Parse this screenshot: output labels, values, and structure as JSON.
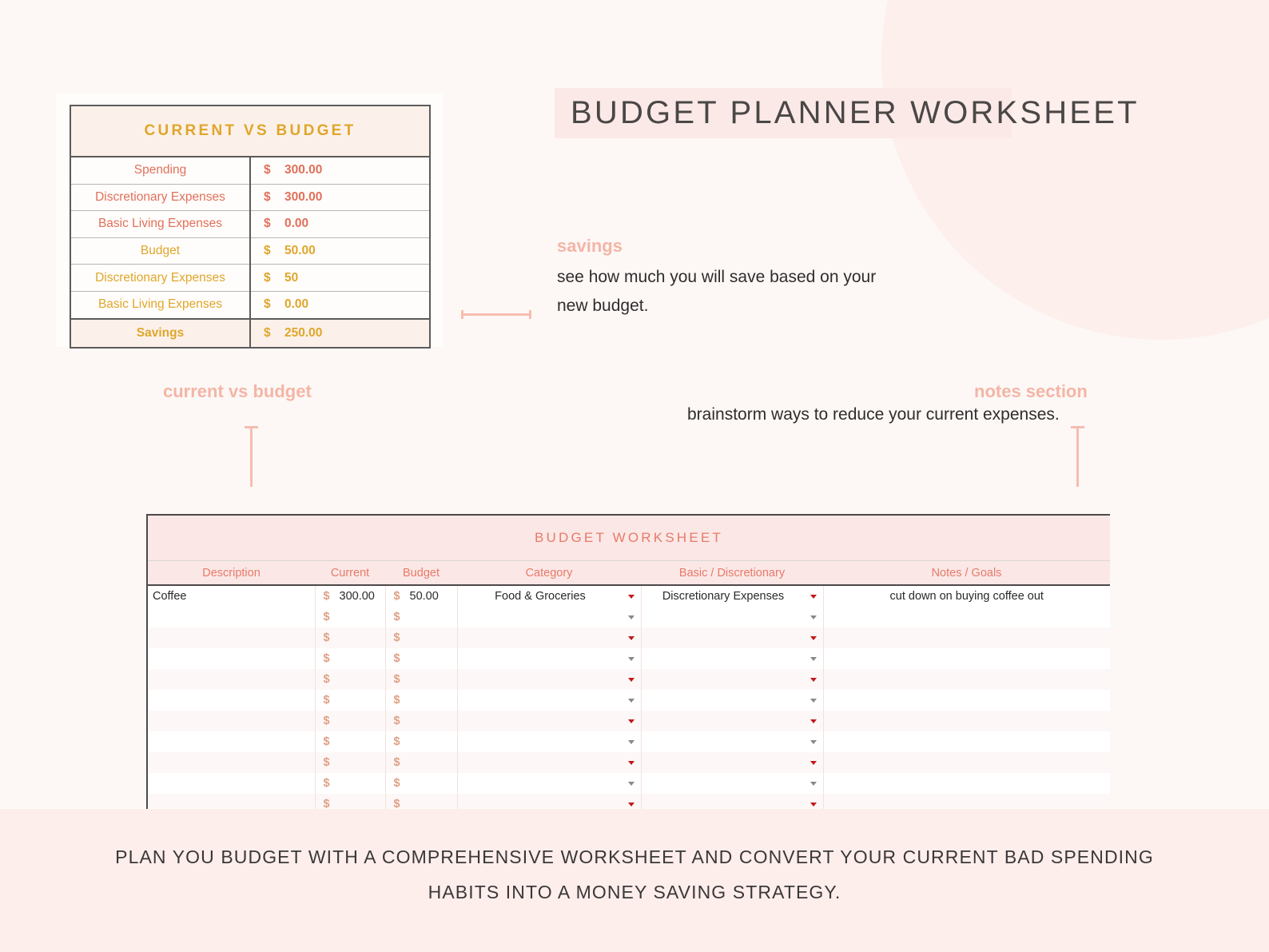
{
  "header": {
    "title": "BUDGET PLANNER WORKSHEET"
  },
  "current_vs_budget": {
    "title": "CURRENT VS BUDGET",
    "currency_symbol": "$",
    "rows": [
      {
        "label": "Spending",
        "value": "300.00",
        "tone": "red"
      },
      {
        "label": "Discretionary Expenses",
        "value": "300.00",
        "tone": "red"
      },
      {
        "label": "Basic Living Expenses",
        "value": "0.00",
        "tone": "red"
      },
      {
        "label": "Budget",
        "value": "50.00",
        "tone": "gold"
      },
      {
        "label": "Discretionary Expenses",
        "value": "50",
        "tone": "gold"
      },
      {
        "label": "Basic Living Expenses",
        "value": "0.00",
        "tone": "gold"
      }
    ],
    "total": {
      "label": "Savings",
      "value": "250.00"
    }
  },
  "annotations": {
    "savings": {
      "title": "savings",
      "line1": "see how much you will save based on your",
      "line2": "new budget."
    },
    "current_vs_budget": {
      "title": "current vs budget"
    },
    "notes": {
      "title": "notes section",
      "body": "brainstorm ways to reduce your current expenses."
    }
  },
  "worksheet": {
    "title": "BUDGET WORKSHEET",
    "columns": [
      "Description",
      "Current",
      "Budget",
      "Category",
      "Basic / Discretionary",
      "Notes / Goals"
    ],
    "currency_symbol": "$",
    "rows": [
      {
        "description": "Coffee",
        "current": "300.00",
        "budget": "50.00",
        "category": "Food & Groceries",
        "basic_discretionary": "Discretionary Expenses",
        "notes": "cut down on buying coffee out",
        "caret": "red"
      },
      {
        "description": "",
        "current": "",
        "budget": "",
        "category": "",
        "basic_discretionary": "",
        "notes": "",
        "caret": "gray"
      },
      {
        "description": "",
        "current": "",
        "budget": "",
        "category": "",
        "basic_discretionary": "",
        "notes": "",
        "caret": "red"
      },
      {
        "description": "",
        "current": "",
        "budget": "",
        "category": "",
        "basic_discretionary": "",
        "notes": "",
        "caret": "gray"
      },
      {
        "description": "",
        "current": "",
        "budget": "",
        "category": "",
        "basic_discretionary": "",
        "notes": "",
        "caret": "red"
      },
      {
        "description": "",
        "current": "",
        "budget": "",
        "category": "",
        "basic_discretionary": "",
        "notes": "",
        "caret": "gray"
      },
      {
        "description": "",
        "current": "",
        "budget": "",
        "category": "",
        "basic_discretionary": "",
        "notes": "",
        "caret": "red"
      },
      {
        "description": "",
        "current": "",
        "budget": "",
        "category": "",
        "basic_discretionary": "",
        "notes": "",
        "caret": "gray"
      },
      {
        "description": "",
        "current": "",
        "budget": "",
        "category": "",
        "basic_discretionary": "",
        "notes": "",
        "caret": "red"
      },
      {
        "description": "",
        "current": "",
        "budget": "",
        "category": "",
        "basic_discretionary": "",
        "notes": "",
        "caret": "gray"
      },
      {
        "description": "",
        "current": "",
        "budget": "",
        "category": "",
        "basic_discretionary": "",
        "notes": "",
        "caret": "red"
      }
    ]
  },
  "footer": {
    "line1": "PLAN YOU BUDGET WITH A COMPREHENSIVE WORKSHEET AND CONVERT YOUR CURRENT BAD SPENDING",
    "line2": "HABITS INTO A MONEY SAVING STRATEGY."
  },
  "colors": {
    "page_background": "#fdf8f6",
    "soft_pink": "#fcefec",
    "band_pink": "#fdeeec",
    "title_band": "#fbe9e7",
    "accent_coral": "#e8796a",
    "accent_gold": "#dfa62a",
    "accent_red": "#e0705a",
    "annotation_pink": "#f4b5a6",
    "leader_pink": "#f6bdaf",
    "caret_red": "#c4161c",
    "caret_gray": "#8a8785",
    "border_dark": "#4c4a49"
  }
}
